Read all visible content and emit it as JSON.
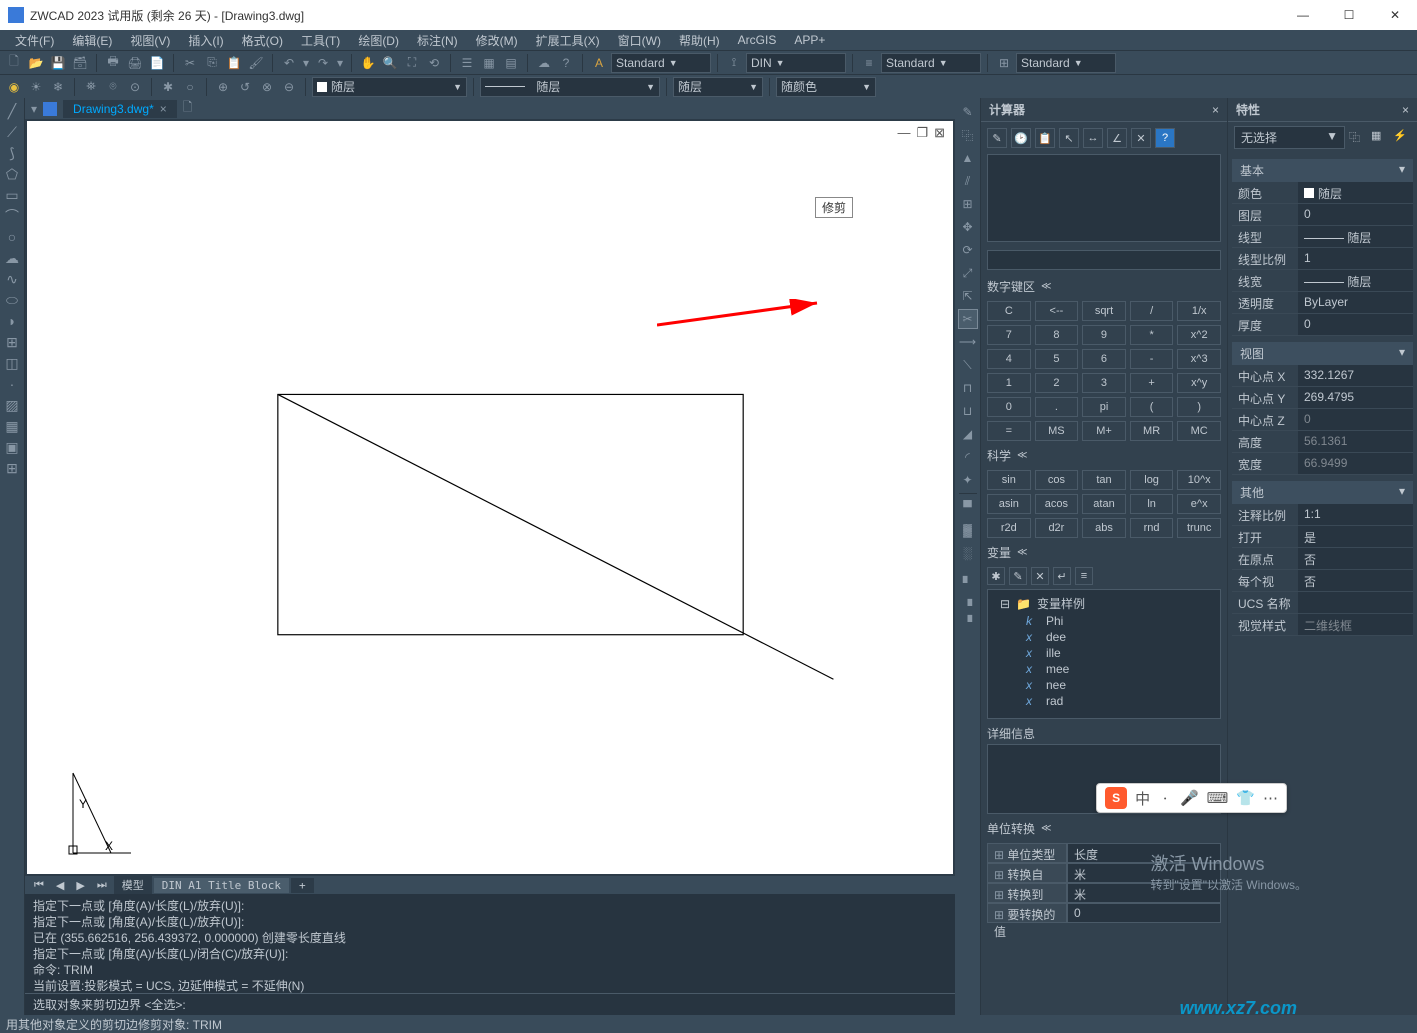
{
  "title": "ZWCAD 2023 试用版 (剩余 26 天) - [Drawing3.dwg]",
  "menu": [
    "文件(F)",
    "编辑(E)",
    "视图(V)",
    "插入(I)",
    "格式(O)",
    "工具(T)",
    "绘图(D)",
    "标注(N)",
    "修改(M)",
    "扩展工具(X)",
    "窗口(W)",
    "帮助(H)",
    "ArcGIS",
    "APP+"
  ],
  "toolbar2": {
    "layer1": "随层",
    "layer2": "随层",
    "layer3": "随层",
    "color": "随颜色"
  },
  "styles": {
    "text": "Standard",
    "dim": "DIN",
    "ml": "Standard",
    "table": "Standard"
  },
  "doc_tab": "Drawing3.dwg*",
  "tooltip": "修剪",
  "layout_tabs": {
    "model": "模型",
    "a1": "DIN A1 Title Block",
    "plus": "+"
  },
  "cmd_lines": [
    "指定下一点或 [角度(A)/长度(L)/放弃(U)]:",
    "指定下一点或 [角度(A)/长度(L)/放弃(U)]:",
    "已在 (355.662516, 256.439372, 0.000000) 创建零长度直线",
    "指定下一点或 [角度(A)/长度(L)/闭合(C)/放弃(U)]:",
    "命令: TRIM",
    "当前设置:投影模式 = UCS, 边延伸模式 = 不延伸(N)"
  ],
  "cmd_prompt": "选取对象来剪切边界 <全选>:",
  "status": "用其他对象定义的剪切边修剪对象: TRIM",
  "calc": {
    "title": "计算器",
    "numpad_hdr": "数字键区",
    "numpad": [
      "C",
      "<--",
      "sqrt",
      "/",
      "1/x",
      "7",
      "8",
      "9",
      "*",
      "x^2",
      "4",
      "5",
      "6",
      "-",
      "x^3",
      "1",
      "2",
      "3",
      "+",
      "x^y",
      "0",
      ".",
      "pi",
      "(",
      ")",
      "=",
      "MS",
      "M+",
      "MR",
      "MC"
    ],
    "sci_hdr": "科学",
    "sci": [
      "sin",
      "cos",
      "tan",
      "log",
      "10^x",
      "asin",
      "acos",
      "atan",
      "ln",
      "e^x",
      "r2d",
      "d2r",
      "abs",
      "rnd",
      "trunc"
    ],
    "var_hdr": "变量",
    "var_root": "变量样例",
    "vars": [
      "Phi",
      "dee",
      "ille",
      "mee",
      "nee",
      "rad"
    ],
    "detail": "详细信息",
    "unit_hdr": "单位转换",
    "unit_rows": [
      {
        "k": "单位类型",
        "v": "长度"
      },
      {
        "k": "转换自",
        "v": "米"
      },
      {
        "k": "转换到",
        "v": "米"
      },
      {
        "k": "要转换的值",
        "v": "0"
      }
    ]
  },
  "props": {
    "title": "特性",
    "no_sel": "无选择",
    "sections": {
      "basic": {
        "hdr": "基本",
        "rows": [
          {
            "k": "颜色",
            "v": "随层",
            "sw": true
          },
          {
            "k": "图层",
            "v": "0"
          },
          {
            "k": "线型",
            "v": "随层",
            "line": true
          },
          {
            "k": "线型比例",
            "v": "1"
          },
          {
            "k": "线宽",
            "v": "随层",
            "line": true
          },
          {
            "k": "透明度",
            "v": "ByLayer"
          },
          {
            "k": "厚度",
            "v": "0"
          }
        ]
      },
      "view": {
        "hdr": "视图",
        "rows": [
          {
            "k": "中心点 X",
            "v": "332.1267"
          },
          {
            "k": "中心点 Y",
            "v": "269.4795"
          },
          {
            "k": "中心点 Z",
            "v": "0",
            "ro": true
          },
          {
            "k": "高度",
            "v": "56.1361",
            "ro": true
          },
          {
            "k": "宽度",
            "v": "66.9499",
            "ro": true
          }
        ]
      },
      "other": {
        "hdr": "其他",
        "rows": [
          {
            "k": "注释比例",
            "v": "1:1"
          },
          {
            "k": "打开 UCS...",
            "v": "是"
          },
          {
            "k": "在原点显...",
            "v": "否"
          },
          {
            "k": "每个视口...",
            "v": "否"
          },
          {
            "k": "UCS 名称",
            "v": ""
          },
          {
            "k": "视觉样式",
            "v": "二维线框",
            "ro": true
          }
        ]
      }
    }
  },
  "watermark": {
    "l1": "激活 Windows",
    "l2": "转到\"设置\"以激活 Windows。"
  },
  "site": "www.xz7.com",
  "ime": {
    "logo": "S",
    "chars": [
      "中",
      "ㆍ",
      "🎤",
      "⌨",
      "👕",
      "⋯"
    ]
  }
}
